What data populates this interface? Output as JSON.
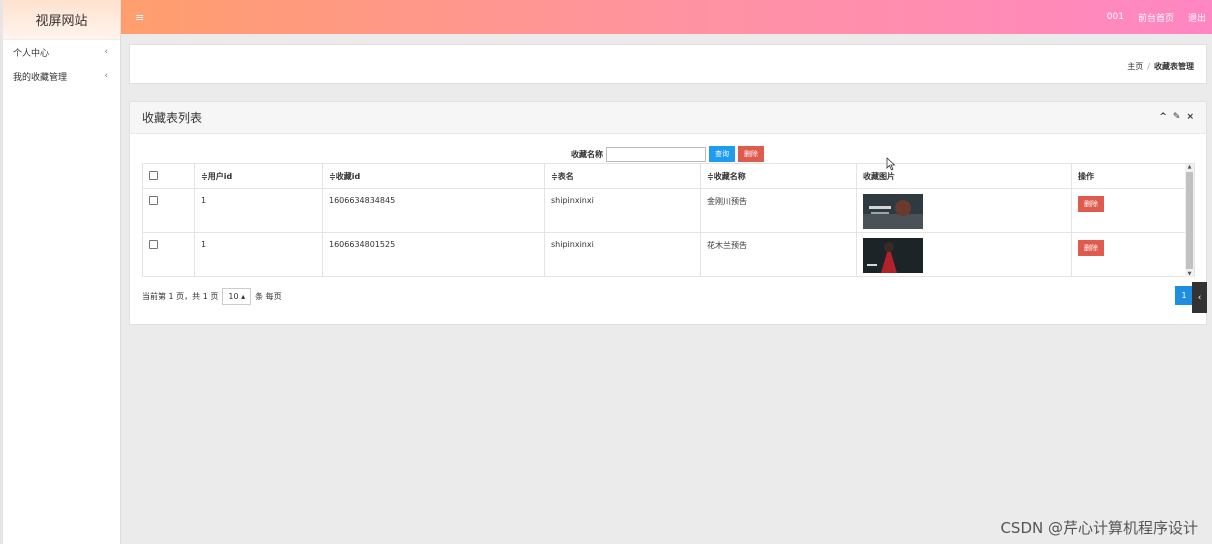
{
  "sidebar": {
    "brand": "视屏网站",
    "items": [
      {
        "label": "个人中心",
        "chevron": "‹"
      },
      {
        "label": "我的收藏管理",
        "chevron": "‹"
      }
    ]
  },
  "topbar": {
    "menu_icon": "≡",
    "user": "001",
    "home_link": "前台首页",
    "logout": "退出"
  },
  "breadcrumb": {
    "home": "主页",
    "separator": "/",
    "current": "收藏表管理"
  },
  "panel": {
    "title": "收藏表列表",
    "tools": [
      "^",
      "✎",
      "×"
    ]
  },
  "search": {
    "label": "收藏名称",
    "value": "",
    "query_button": "查询",
    "delete_button": "删除"
  },
  "table": {
    "headers": [
      "",
      "≑用户id",
      "≑收藏id",
      "≑表名",
      "≑收藏名称",
      "收藏图片",
      "操作"
    ],
    "rows": [
      {
        "user_id": "1",
        "fav_id": "1606634834845",
        "table_name": "shipinxinxi",
        "fav_name": "金刚川预告",
        "delete": "删除"
      },
      {
        "user_id": "1",
        "fav_id": "1606634801525",
        "table_name": "shipinxinxi",
        "fav_name": "花木兰预告",
        "delete": "删除"
      }
    ]
  },
  "pager": {
    "info": "当前第 1 页，共 1 页",
    "per_page": "10",
    "per_page_suffix": "条 每页",
    "page": "1"
  },
  "watermark": "CSDN @芹心计算机程序设计",
  "colors": {
    "topbar_start": "#ff9e6d",
    "topbar_end": "#ff86c3",
    "primary": "#1e9cf0",
    "danger": "#e05b4e"
  }
}
